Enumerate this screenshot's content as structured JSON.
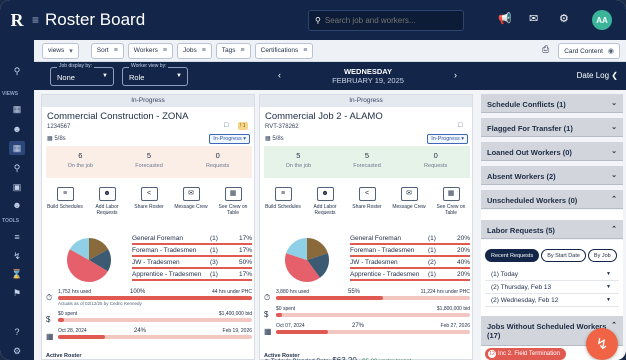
{
  "app": {
    "logo": "R",
    "title": "Roster Board"
  },
  "search": {
    "placeholder": "Search job and workers..."
  },
  "user": {
    "initials": "AA"
  },
  "rail": {
    "sections": [
      "VIEWS",
      "TOOLS"
    ]
  },
  "filters": {
    "views": "views",
    "sort": "Sort",
    "workers": "Workers",
    "jobs": "Jobs",
    "tags": "Tags",
    "certifications": "Certifications",
    "card_content": "Card Content"
  },
  "selectors": {
    "job_display": {
      "caption": "Job display by:",
      "value": "None"
    },
    "worker_view": {
      "caption": "Worker view by:",
      "value": "Role"
    }
  },
  "date": {
    "weekday": "WEDNESDAY",
    "date": "FEBRUARY 19, 2025"
  },
  "date_log": "Date Log",
  "cards": [
    {
      "status_header": "In-Progress",
      "title": "Commercial Construction - ZONA",
      "code": "1234567",
      "shifts": "5/8s",
      "badge": "1",
      "status": "In-Progress",
      "stats": [
        {
          "n": "6",
          "l": "On the job"
        },
        {
          "n": "5",
          "l": "Forecasted"
        },
        {
          "n": "0",
          "l": "Requests"
        }
      ],
      "stats_bg": "#fbeee6",
      "actions": [
        "Build Schedules",
        "Add Labor Requests",
        "Share Roster",
        "Message Crew",
        "See Crew on Table"
      ],
      "roles": [
        {
          "name": "General Foreman",
          "count": "(1)",
          "pct": "17%"
        },
        {
          "name": "Foreman - Tradesmen",
          "count": "(1)",
          "pct": "17%"
        },
        {
          "name": "JW - Tradesmen",
          "count": "(3)",
          "pct": "50%"
        },
        {
          "name": "Apprentice - Tradesmen",
          "count": "(1)",
          "pct": "17%"
        }
      ],
      "pie": [
        0.17,
        0.17,
        0.5,
        0.17
      ],
      "hours": {
        "used": "1,752 hrs used",
        "pct": "100%",
        "under": "44 hrs under PHC",
        "fill": 1.0,
        "note": "Actuals as of 02/12/25 by Cedric Kennedy"
      },
      "cost": {
        "spent": "$0 spent",
        "pct": "0%",
        "budget": "$1,400,000 bid",
        "fill": 0.0
      },
      "dates": {
        "start": "Oct 28, 2024",
        "pct": "24%",
        "end": "Feb 19, 2026",
        "fill": 0.24
      },
      "active_roster": "Active Roster"
    },
    {
      "status_header": "In-Progress",
      "title": "Commercial Job 2 - ALAMO",
      "code": "RVT-378262",
      "shifts": "5/8s",
      "badge": "",
      "status": "In-Progress",
      "stats": [
        {
          "n": "5",
          "l": "On the job"
        },
        {
          "n": "5",
          "l": "Forecasted"
        },
        {
          "n": "0",
          "l": "Requests"
        }
      ],
      "stats_bg": "#e6f3e8",
      "actions": [
        "Build Schedules",
        "Add Labor Requests",
        "Share Roster",
        "Message Crew",
        "See Crew on Table"
      ],
      "roles": [
        {
          "name": "General Foreman",
          "count": "(1)",
          "pct": "20%"
        },
        {
          "name": "Foreman - Tradesmen",
          "count": "(1)",
          "pct": "20%"
        },
        {
          "name": "JW - Tradesmen",
          "count": "(2)",
          "pct": "40%"
        },
        {
          "name": "Apprentice - Tradesmen",
          "count": "(1)",
          "pct": "20%"
        }
      ],
      "pie": [
        0.2,
        0.2,
        0.4,
        0.2
      ],
      "hours": {
        "used": "3,880 hrs used",
        "pct": "55%",
        "under": "11,224 hrs under PHC",
        "fill": 0.55,
        "note": ""
      },
      "cost": {
        "spent": "$0 spent",
        "pct": "0%",
        "budget": "$1,800,000 bid",
        "fill": 0.0
      },
      "dates": {
        "start": "Oct 07, 2024",
        "pct": "27%",
        "end": "Feb 27, 2026",
        "fill": 0.27
      },
      "active_roster": "Active Roster",
      "blended": {
        "label": "Today's Blended Rate:",
        "value": "$63.20",
        "delta": "• $5.80 under target"
      }
    }
  ],
  "pie_colors": [
    "#8a6a3b",
    "#3d5a73",
    "#e5606b",
    "#8fd0e6"
  ],
  "right_panel": {
    "schedule_conflicts": "Schedule Conflicts (1)",
    "flagged_transfer": "Flagged For Transfer (1)",
    "loaned_out": "Loaned Out Workers (0)",
    "absent": "Absent Workers (2)",
    "unscheduled": "Unscheduled Workers (0)",
    "labor_requests": "Labor Requests (5)",
    "lr_tabs": [
      "Recent Requests",
      "By Start Date",
      "By Job"
    ],
    "lr_rows": [
      "(1) Today",
      "(2) Thursday, Feb 13",
      "(2) Wednesday, Feb 12"
    ],
    "jobs_without": "Jobs Without Scheduled Workers (17)",
    "tag": {
      "num": "12",
      "label": "Inc 2. Field Termination"
    }
  }
}
